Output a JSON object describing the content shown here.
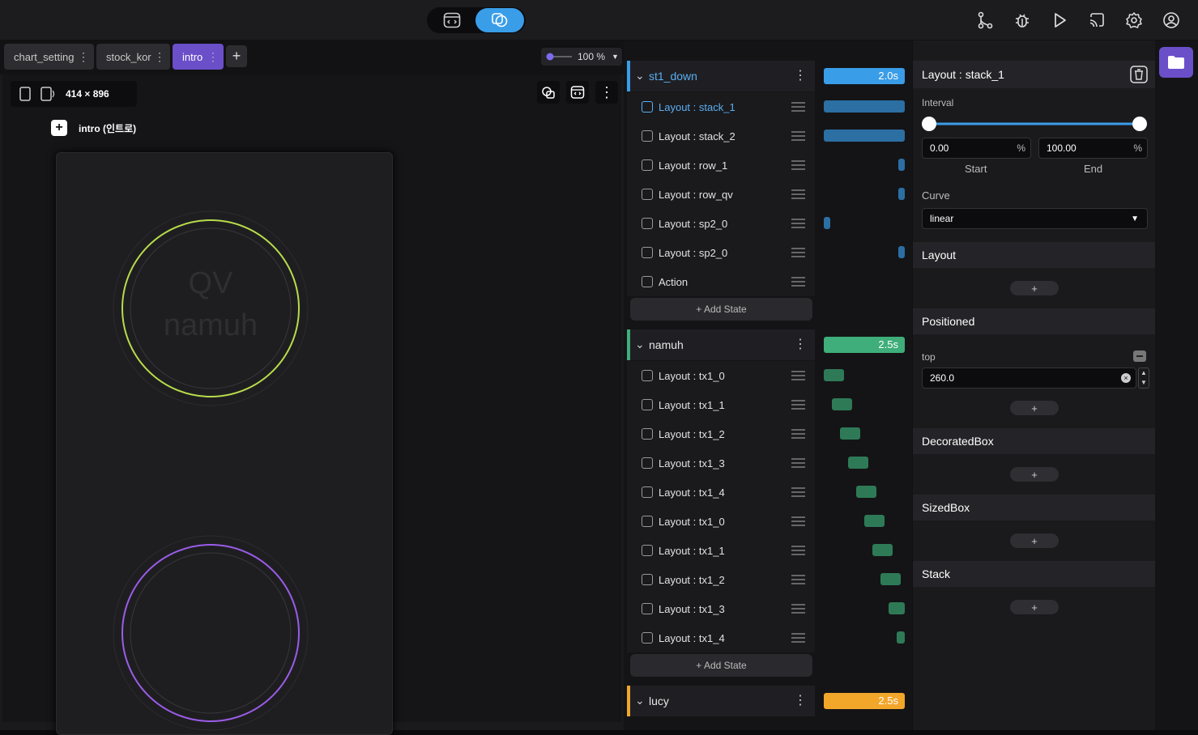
{
  "tabs": [
    "chart_setting",
    "stock_kor",
    "intro"
  ],
  "zoom": "100 %",
  "device": "414 × 896",
  "screen_label": "intro (인트로)",
  "logo_lines": [
    "QV",
    "namuh"
  ],
  "groups": [
    {
      "name": "st1_down",
      "duration": "2.0s",
      "color": "#3a9de8",
      "rows": [
        "Layout : stack_1",
        "Layout : stack_2",
        "Layout : row_1",
        "Layout : row_qv",
        "Layout : sp2_0",
        "Layout : sp2_0",
        "Action"
      ]
    },
    {
      "name": "namuh",
      "duration": "2.5s",
      "color": "#3fae7a",
      "rows": [
        "Layout : tx1_0",
        "Layout : tx1_1",
        "Layout : tx1_2",
        "Layout : tx1_3",
        "Layout : tx1_4",
        "Layout : tx1_0",
        "Layout : tx1_1",
        "Layout : tx1_2",
        "Layout : tx1_3",
        "Layout : tx1_4"
      ]
    },
    {
      "name": "lucy",
      "duration": "2.5s",
      "color": "#f2a62a",
      "rows": []
    }
  ],
  "add_state": "+ Add State",
  "inspector": {
    "title": "Layout : stack_1",
    "interval_label": "Interval",
    "start_value": "0.00",
    "end_value": "100.00",
    "percent": "%",
    "start_label": "Start",
    "end_label": "End",
    "curve_label": "Curve",
    "curve_value": "linear",
    "layout_label": "Layout",
    "positioned_label": "Positioned",
    "top_label": "top",
    "top_value": "260.0",
    "decorated_label": "DecoratedBox",
    "sizedbox_label": "SizedBox",
    "stack_label": "Stack",
    "plus": "+"
  },
  "icons": [
    "code-icon",
    "shapes-icon",
    "branch-icon",
    "bug-icon",
    "play-icon",
    "cast-icon",
    "gear-icon",
    "account-icon",
    "folder-icon"
  ]
}
